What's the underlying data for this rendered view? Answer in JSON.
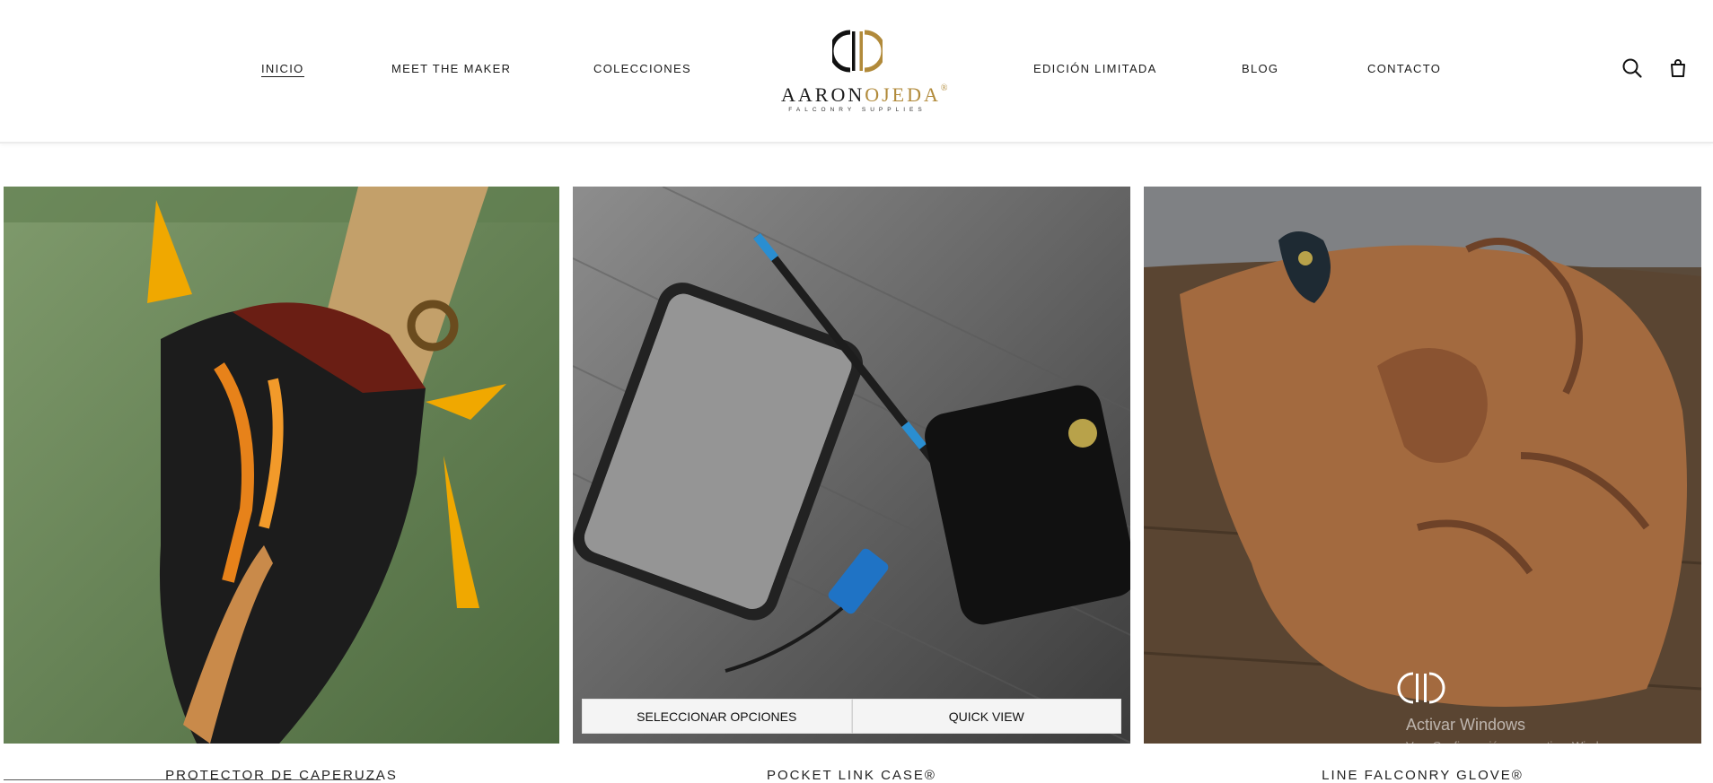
{
  "header": {
    "nav_left": [
      "INICIO",
      "MEET THE MAKER",
      "COLECCIONES"
    ],
    "nav_right": [
      "EDICIÓN LIMITADA",
      "BLOG",
      "CONTACTO"
    ],
    "active_item": "INICIO",
    "logo": {
      "word_part1": "AARON",
      "word_part2": "OJEDA",
      "registered": "®",
      "tagline": "FALCONRY SUPPLIES"
    },
    "icons": [
      "search-icon",
      "shopping-bag-icon"
    ]
  },
  "products": [
    {
      "title": "PROTECTOR DE CAPERUZAS"
    },
    {
      "title": "POCKET LINK CASE®"
    },
    {
      "title": "LINE FALCONRY GLOVE®"
    }
  ],
  "overlay": {
    "select_options": "SELECCIONAR OPCIONES",
    "quick_view": "QUICK VIEW"
  },
  "os_watermark": {
    "title": "Activar Windows",
    "subtitle": "Ve a Configuración para activar Windows."
  },
  "colors": {
    "brand_gold": "#b18a3a",
    "text_dark": "#1a1a1a"
  }
}
